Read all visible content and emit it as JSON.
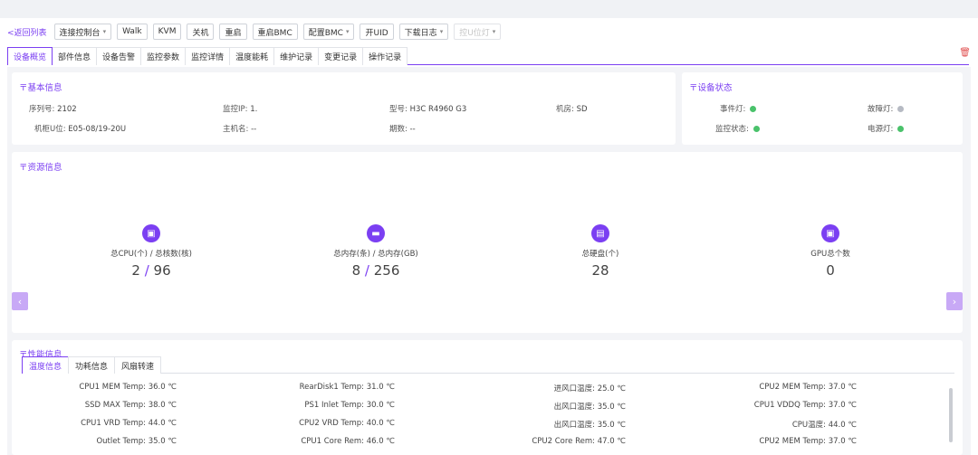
{
  "toolbar": {
    "back": "<返回列表",
    "buttons": [
      {
        "label": "连接控制台",
        "dropdown": true,
        "disabled": false
      },
      {
        "label": "Walk",
        "dropdown": false,
        "disabled": false
      },
      {
        "label": "KVM",
        "dropdown": false,
        "disabled": false
      },
      {
        "label": "关机",
        "dropdown": false,
        "disabled": false
      },
      {
        "label": "重启",
        "dropdown": false,
        "disabled": false
      },
      {
        "label": "重启BMC",
        "dropdown": false,
        "disabled": false
      },
      {
        "label": "配置BMC",
        "dropdown": true,
        "disabled": false
      },
      {
        "label": "开UID",
        "dropdown": false,
        "disabled": false
      },
      {
        "label": "下载日志",
        "dropdown": true,
        "disabled": false
      },
      {
        "label": "控U位灯",
        "dropdown": true,
        "disabled": true
      }
    ]
  },
  "tabs": [
    "设备概览",
    "部件信息",
    "设备告警",
    "监控参数",
    "监控详情",
    "温度能耗",
    "维护记录",
    "变更记录",
    "操作记录"
  ],
  "active_tab": "设备概览",
  "basic": {
    "title": "〒基本信息",
    "rows": [
      [
        {
          "k": "序列号:",
          "v": "2102"
        },
        {
          "k": "监控IP:",
          "v": "1."
        },
        {
          "k": "型号:",
          "v": "H3C R4960 G3"
        },
        {
          "k": "机房:",
          "v": "SD"
        }
      ],
      [
        {
          "k": "机柜U位:",
          "v": "E05-08/19-20U"
        },
        {
          "k": "主机名:",
          "v": "--"
        },
        {
          "k": "期数:",
          "v": "--"
        }
      ]
    ]
  },
  "status": {
    "title": "〒设备状态",
    "items": [
      {
        "label": "事件灯:",
        "color": "green"
      },
      {
        "label": "故障灯:",
        "color": "gray"
      },
      {
        "label": "监控状态:",
        "color": "green"
      },
      {
        "label": "电源灯:",
        "color": "green"
      }
    ]
  },
  "resources": {
    "title": "〒资源信息",
    "items": [
      {
        "label": "总CPU(个) / 总核数(核)",
        "value_a": "2",
        "sep": "/",
        "value_b": "96",
        "icon": "cpu-icon"
      },
      {
        "label": "总内存(条) / 总内存(GB)",
        "value_a": "8",
        "sep": "/",
        "value_b": "256",
        "icon": "memory-icon"
      },
      {
        "label": "总硬盘(个)",
        "value_a": "28",
        "sep": "",
        "value_b": "",
        "icon": "disk-icon"
      },
      {
        "label": "GPU总个数",
        "value_a": "0",
        "sep": "",
        "value_b": "",
        "icon": "gpu-icon"
      }
    ],
    "prev": "‹",
    "next": "›"
  },
  "performance": {
    "title": "〒性能信息",
    "subtabs": [
      "温度信息",
      "功耗信息",
      "风扇转速"
    ],
    "active_subtab": "温度信息",
    "rows": [
      [
        {
          "k": "CPU1 MEM Temp:",
          "v": "36.0 ℃"
        },
        {
          "k": "RearDisk1 Temp:",
          "v": "31.0 ℃"
        },
        {
          "k": "进风口温度:",
          "v": "25.0 ℃"
        },
        {
          "k": "CPU2 MEM Temp:",
          "v": "37.0 ℃"
        }
      ],
      [
        {
          "k": "SSD MAX Temp:",
          "v": "38.0 ℃"
        },
        {
          "k": "PS1 Inlet Temp:",
          "v": "30.0 ℃"
        },
        {
          "k": "出风口温度:",
          "v": "35.0 ℃"
        },
        {
          "k": "CPU1 VDDQ Temp:",
          "v": "37.0 ℃"
        }
      ],
      [
        {
          "k": "CPU1 VRD Temp:",
          "v": "44.0 ℃"
        },
        {
          "k": "CPU2 VRD Temp:",
          "v": "40.0 ℃"
        },
        {
          "k": "出风口温度:",
          "v": "35.0 ℃"
        },
        {
          "k": "CPU温度:",
          "v": "44.0 ℃"
        }
      ],
      [
        {
          "k": "Outlet Temp:",
          "v": "35.0 ℃"
        },
        {
          "k": "CPU1 Core Rem:",
          "v": "46.0 ℃"
        },
        {
          "k": "CPU2 Core Rem:",
          "v": "47.0 ℃"
        },
        {
          "k": "CPU2 MEM Temp:",
          "v": "37.0 ℃"
        }
      ]
    ]
  },
  "colors": {
    "accent": "#7b3ff2",
    "green": "#4ac26b",
    "gray": "#b6bac3"
  }
}
